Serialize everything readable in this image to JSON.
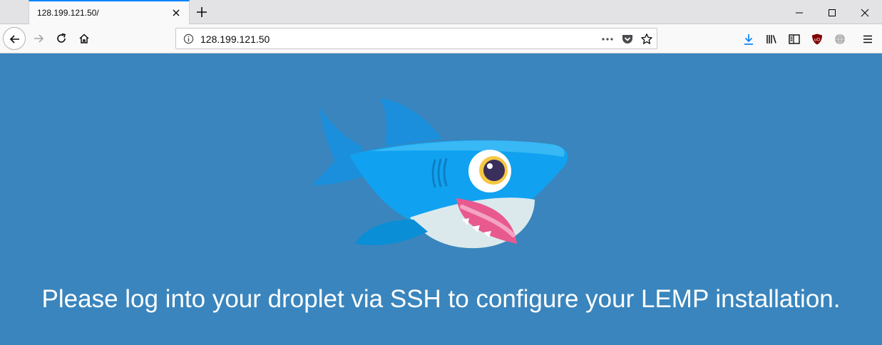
{
  "browser": {
    "tab_title": "128.199.121.50/",
    "url": "128.199.121.50",
    "accent_color": "#0a84ff"
  },
  "icons": {
    "tab_close": "close-icon",
    "new_tab": "plus-icon",
    "back": "back-arrow-icon",
    "forward": "forward-arrow-icon",
    "reload": "reload-icon",
    "home": "home-icon",
    "site_info": "info-icon",
    "page_actions": "more-icon",
    "pocket": "pocket-icon",
    "bookmark": "star-icon",
    "downloads": "download-icon",
    "library": "library-icon",
    "sidebar": "sidebar-icon",
    "ublock": "ublock-shield-icon",
    "globe": "globe-icon",
    "menu": "hamburger-menu-icon"
  },
  "page": {
    "background_color": "#3a85bd",
    "message": "Please log into your droplet via SSH to configure your LEMP installation."
  }
}
